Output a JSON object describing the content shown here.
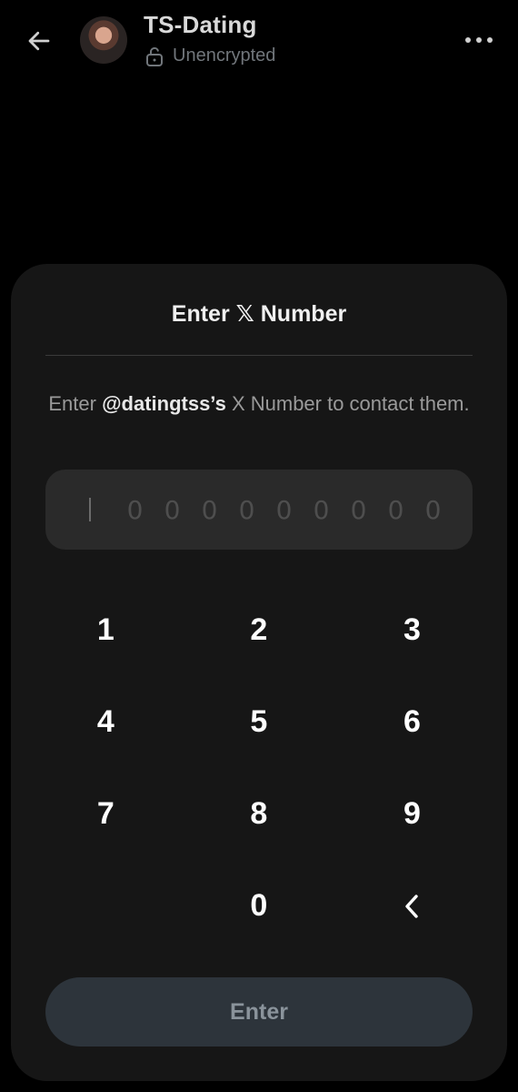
{
  "header": {
    "title": "TS-Dating",
    "status": "Unencrypted",
    "back_icon": "arrow-left-icon",
    "more_icon": "more-horizontal-icon",
    "lock_icon": "unlocked-padlock-icon"
  },
  "dialog": {
    "title_prefix": "Enter ",
    "title_brand": "𝕏",
    "title_suffix": " Number",
    "description_prefix": "Enter ",
    "description_handle": "@datingtss’s",
    "description_suffix": " X Number to contact them.",
    "input": {
      "value": "",
      "placeholder_digits": [
        "0",
        "0",
        "0",
        "0",
        "0",
        "0",
        "0",
        "0",
        "0"
      ]
    },
    "keypad": {
      "row1": [
        "1",
        "2",
        "3"
      ],
      "row2": [
        "4",
        "5",
        "6"
      ],
      "row3": [
        "7",
        "8",
        "9"
      ],
      "row4": [
        "",
        "0",
        "‹"
      ]
    },
    "submit_label": "Enter"
  },
  "colors": {
    "background": "#000000",
    "sheet": "#161616",
    "field": "#2a2a2a",
    "button_disabled": "#2d343b",
    "muted_text": "#71767b"
  }
}
